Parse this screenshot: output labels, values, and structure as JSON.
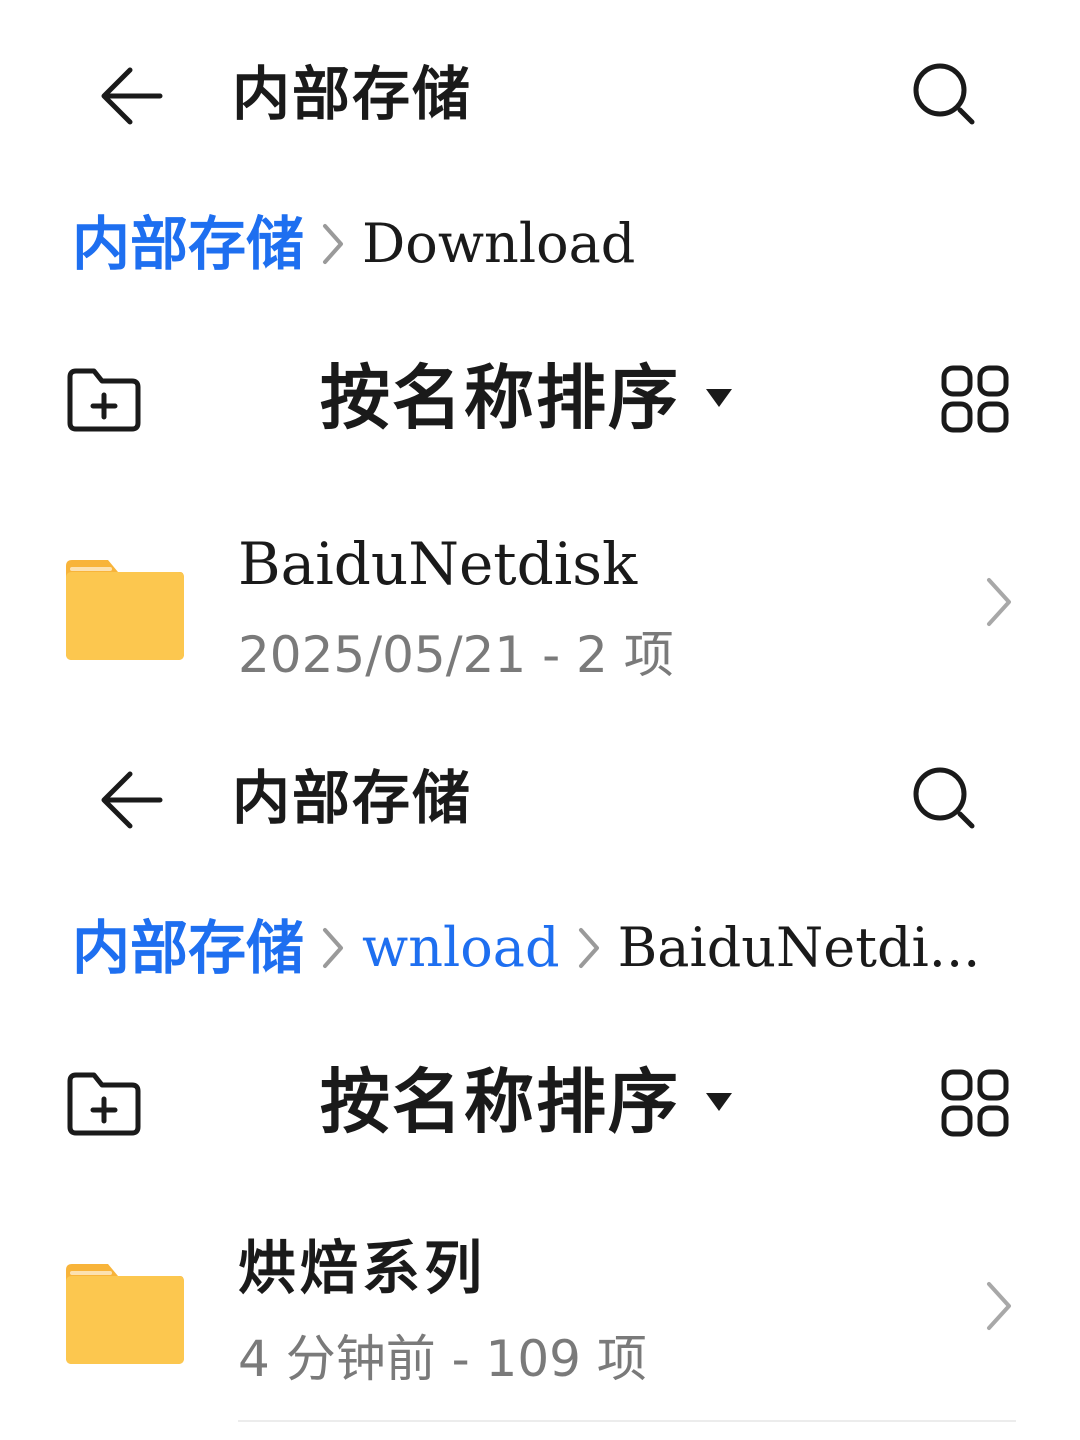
{
  "panels": [
    {
      "title": "内部存储",
      "breadcrumb": {
        "links": [
          "内部存储"
        ],
        "current": "Download"
      },
      "toolbar": {
        "sort_label": "按名称排序"
      },
      "items": [
        {
          "name": "BaiduNetdisk",
          "meta": "2025/05/21 - 2 项"
        }
      ]
    },
    {
      "title": "内部存储",
      "breadcrumb": {
        "links": [
          "内部存储",
          "wnload"
        ],
        "current": "BaiduNetdi..."
      },
      "toolbar": {
        "sort_label": "按名称排序"
      },
      "items": [
        {
          "name": "烘焙系列",
          "meta": "4 分钟前 - 109 项"
        }
      ]
    }
  ],
  "icons": {
    "back": "arrow-left-icon",
    "search": "search-icon",
    "new_folder": "folder-add-icon",
    "sort_caret": "caret-down-icon",
    "view_toggle": "grid-view-icon",
    "folder": "folder-icon",
    "chevron": "chevron-right-icon"
  },
  "colors": {
    "accent": "#1e6ff0",
    "text_primary": "#1a1a1a",
    "text_secondary": "#7a7a7a",
    "folder_body": "#fcc74f",
    "folder_tab": "#f8b43a"
  }
}
